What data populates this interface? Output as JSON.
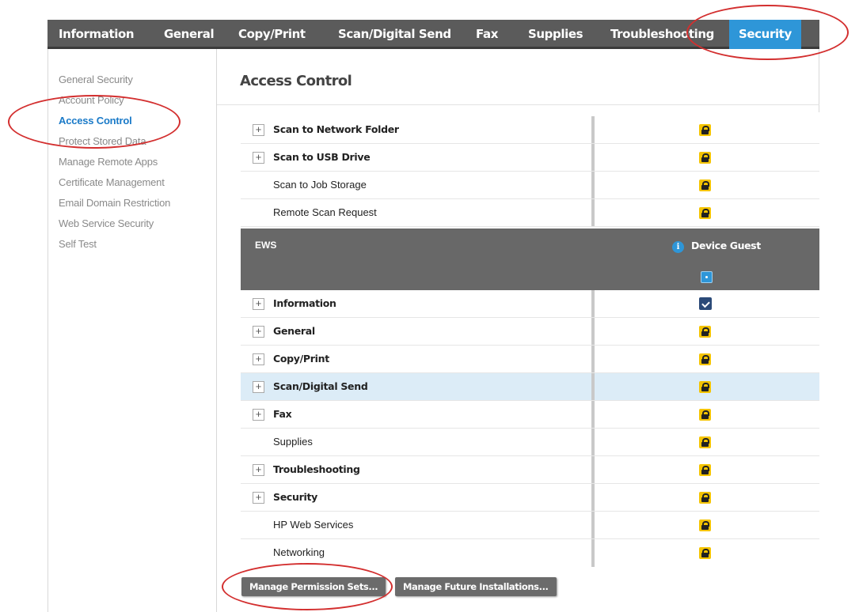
{
  "nav": {
    "tabs": [
      {
        "label": "Information"
      },
      {
        "label": "General"
      },
      {
        "label": "Copy/Print"
      },
      {
        "label": "Scan/Digital Send"
      },
      {
        "label": "Fax"
      },
      {
        "label": "Supplies"
      },
      {
        "label": "Troubleshooting"
      },
      {
        "label": "Security"
      }
    ],
    "active_tab": "Security",
    "active_color": "#2e96d8"
  },
  "sidebar": {
    "items": [
      {
        "label": "General Security"
      },
      {
        "label": "Account Policy"
      },
      {
        "label": "Access Control"
      },
      {
        "label": "Protect Stored Data"
      },
      {
        "label": "Manage Remote Apps"
      },
      {
        "label": "Certificate Management"
      },
      {
        "label": "Email Domain Restriction"
      },
      {
        "label": "Web Service Security"
      },
      {
        "label": "Self Test"
      }
    ],
    "active_item": "Access Control"
  },
  "page": {
    "title": "Access Control"
  },
  "table": {
    "rows_top": [
      {
        "label": "Scan to Network Folder",
        "expandable": true,
        "status": "lock"
      },
      {
        "label": "Scan to USB Drive",
        "expandable": true,
        "status": "lock"
      },
      {
        "label": "Scan to Job Storage",
        "expandable": false,
        "status": "lock"
      },
      {
        "label": "Remote Scan Request",
        "expandable": false,
        "status": "lock"
      }
    ],
    "section": {
      "name": "EWS",
      "info_icon": "info-icon",
      "column_label": "Device Guest"
    },
    "rows_ews": [
      {
        "label": "Information",
        "expandable": true,
        "status": "checked"
      },
      {
        "label": "General",
        "expandable": true,
        "status": "lock"
      },
      {
        "label": "Copy/Print",
        "expandable": true,
        "status": "lock"
      },
      {
        "label": "Scan/Digital Send",
        "expandable": true,
        "status": "lock"
      },
      {
        "label": "Fax",
        "expandable": true,
        "status": "lock"
      },
      {
        "label": "Supplies",
        "expandable": false,
        "status": "lock"
      },
      {
        "label": "Troubleshooting",
        "expandable": true,
        "status": "lock"
      },
      {
        "label": "Security",
        "expandable": true,
        "status": "lock"
      },
      {
        "label": "HP Web Services",
        "expandable": false,
        "status": "lock"
      },
      {
        "label": "Networking",
        "expandable": false,
        "status": "lock"
      }
    ],
    "expander_symbol": "+",
    "lock_color": "#f5c400",
    "highlight_color": "#dcecf7"
  },
  "buttons": {
    "manage_permission_sets": "Manage Permission Sets...",
    "manage_future_installations": "Manage Future Installations..."
  },
  "annotation_color": "#d32f2f"
}
